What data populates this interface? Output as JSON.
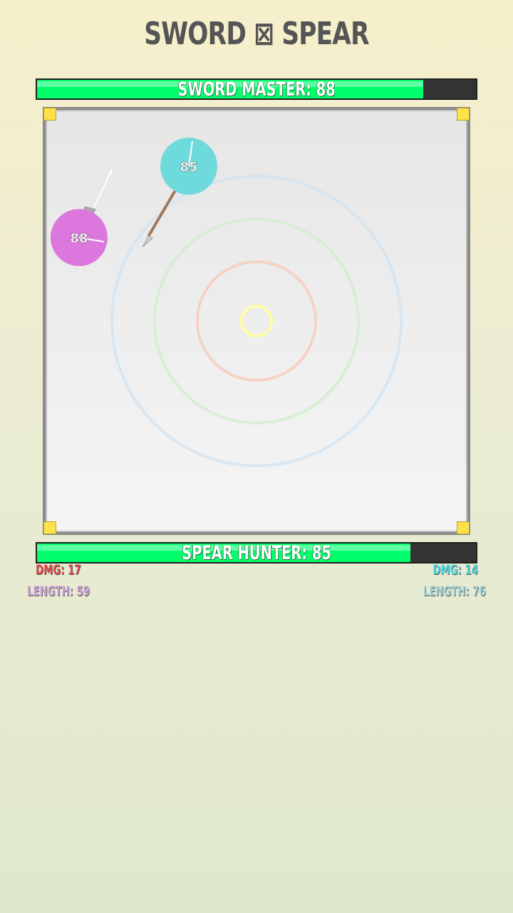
{
  "title": "SWORD ⊠ SPEAR",
  "top_bar": {
    "label": "SWORD MASTER: 88",
    "hp_fraction": 0.88
  },
  "bottom_bar": {
    "label": "SPEAR HUNTER: 85",
    "hp_fraction": 0.85
  },
  "arena": {
    "sword_ball": {
      "hp": "88",
      "color": "#dc77dd"
    },
    "spear_ball": {
      "hp": "85",
      "color": "#6edadc"
    },
    "ring_colors": [
      "#ffff99",
      "#f8c8b8",
      "#cfeecb",
      "#cfe3f2"
    ],
    "corner_color": "#ffe14a"
  },
  "stats": {
    "left_dmg": "DMG: 17",
    "right_dmg": "DMG: 14",
    "left_length": "LENGTH: 59",
    "right_length": "LENGTH: 76",
    "left_color": "#e0474c",
    "right_color": "#4fd6dd",
    "left_length_color": "#c9a0d6",
    "right_length_color": "#9fd4d8"
  }
}
